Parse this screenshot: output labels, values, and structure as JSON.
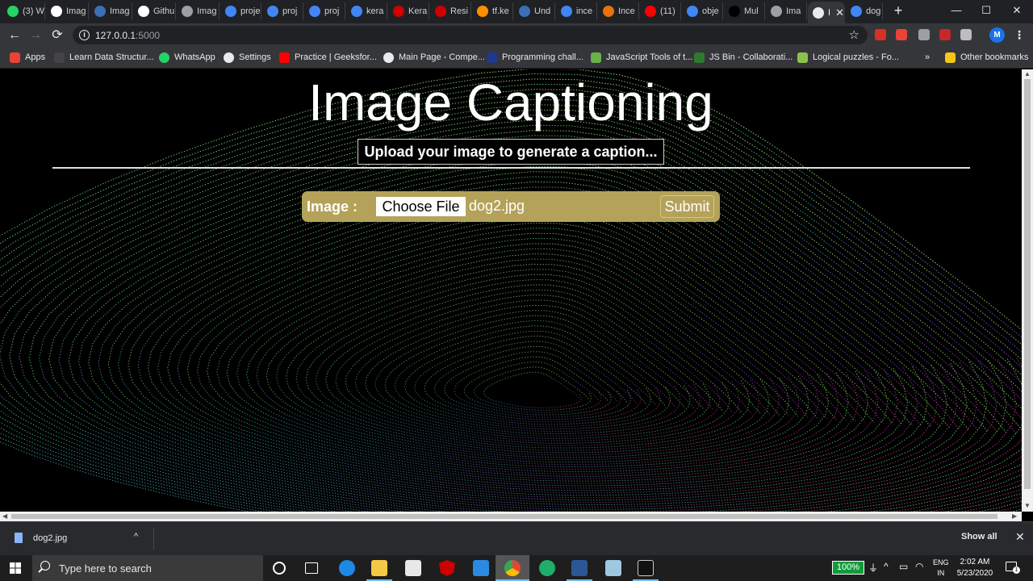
{
  "browser": {
    "tabs": [
      {
        "label": "(3) W",
        "icon": "whatsapp-icon",
        "color": "#25d366"
      },
      {
        "label": "Imag",
        "icon": "github-icon",
        "color": "#ffffff"
      },
      {
        "label": "Imag",
        "icon": "tds-icon",
        "color": "#3b6fb6"
      },
      {
        "label": "Githu",
        "icon": "github-icon",
        "color": "#ffffff"
      },
      {
        "label": "Imag",
        "icon": "globe-icon",
        "color": "#9aa0a6"
      },
      {
        "label": "proje",
        "icon": "google-icon",
        "color": "#4285f4"
      },
      {
        "label": "proj",
        "icon": "docs-icon",
        "color": "#4285f4"
      },
      {
        "label": "proj",
        "icon": "docs-icon",
        "color": "#4285f4"
      },
      {
        "label": "kera",
        "icon": "google-icon",
        "color": "#4285f4"
      },
      {
        "label": "Kera",
        "icon": "k-icon",
        "color": "#d00000"
      },
      {
        "label": "Resi",
        "icon": "k-icon",
        "color": "#d00000"
      },
      {
        "label": "tf.ke",
        "icon": "tensorflow-icon",
        "color": "#ff8f00"
      },
      {
        "label": "Und",
        "icon": "tds-icon",
        "color": "#3b6fb6"
      },
      {
        "label": "ince",
        "icon": "google-icon",
        "color": "#4285f4"
      },
      {
        "label": "Ince",
        "icon": "arrow-icon",
        "color": "#e8710a"
      },
      {
        "label": "(11)",
        "icon": "youtube-icon",
        "color": "#ff0000"
      },
      {
        "label": "obje",
        "icon": "google-icon",
        "color": "#4285f4"
      },
      {
        "label": "Mul",
        "icon": "medium-icon",
        "color": "#000000"
      },
      {
        "label": "Ima",
        "icon": "globe-icon",
        "color": "#9aa0a6"
      },
      {
        "label": "I",
        "icon": "globe-icon",
        "color": "#e8eaed",
        "active": true
      },
      {
        "label": "dog",
        "icon": "google-icon",
        "color": "#4285f4"
      }
    ],
    "new_tab": "+",
    "window_controls": {
      "minimize": "—",
      "maximize": "☐",
      "close": "✕"
    },
    "url_host": "127.0.0.1",
    "url_port": ":5000",
    "avatar_letter": "M",
    "bookmarks": [
      {
        "label": "Apps",
        "icon": "apps-grid-icon",
        "color": "#ea4335"
      },
      {
        "label": "Learn Data Structur...",
        "icon": "bookmark-site-icon",
        "color": "#444444"
      },
      {
        "label": "WhatsApp",
        "icon": "whatsapp-icon",
        "color": "#25d366"
      },
      {
        "label": "Settings",
        "icon": "gear-icon",
        "color": "#e8eaed"
      },
      {
        "label": "Practice | Geeksfor...",
        "icon": "youtube-icon",
        "color": "#ff0000"
      },
      {
        "label": "Main Page - Compe...",
        "icon": "globe-icon",
        "color": "#e8eaed"
      },
      {
        "label": "Programming chall...",
        "icon": "site-icon",
        "color": "#1f3a8a"
      },
      {
        "label": "JavaScript Tools of t...",
        "icon": "leaf-icon",
        "color": "#6ab04c"
      },
      {
        "label": "JS Bin - Collaborati...",
        "icon": "jsbin-icon",
        "color": "#2d7a2d"
      },
      {
        "label": "Logical puzzles - Fo...",
        "icon": "leaf-icon",
        "color": "#8bc34a"
      }
    ],
    "bookmarks_more": "»",
    "other_bookmarks": "Other bookmarks"
  },
  "page": {
    "title": "Image Captioning",
    "subtitle": "Upload your image to generate a caption...",
    "form": {
      "label": "Image :",
      "choose_file": "Choose File",
      "file_name": "dog2.jpg",
      "submit": "Submit",
      "bar_color": "#b4a25a"
    }
  },
  "downloads": {
    "file": "dog2.jpg",
    "show_all": "Show all"
  },
  "taskbar": {
    "search_placeholder": "Type here to search",
    "battery": "100%",
    "lang_top": "ENG",
    "lang_bottom": "IN",
    "time": "2:02 AM",
    "date": "5/23/2020",
    "notification_count": "1"
  }
}
